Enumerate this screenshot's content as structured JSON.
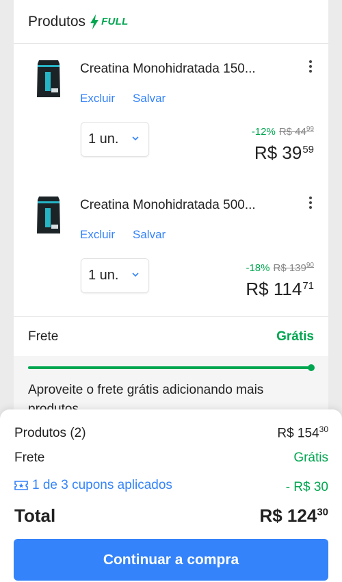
{
  "header": {
    "title": "Produtos",
    "badge": "FULL"
  },
  "items": [
    {
      "title": "Creatina Monohidratada 150...",
      "remove_label": "Excluir",
      "save_label": "Salvar",
      "quantity": "1 un.",
      "discount": "-12%",
      "old_price_int": "R$ 44",
      "old_price_cents": "99",
      "price_int": "R$ 39",
      "price_cents": "59"
    },
    {
      "title": "Creatina Monohidratada 500...",
      "remove_label": "Excluir",
      "save_label": "Salvar",
      "quantity": "1 un.",
      "discount": "-18%",
      "old_price_int": "R$ 139",
      "old_price_cents": "90",
      "price_int": "R$ 114",
      "price_cents": "71"
    }
  ],
  "shipping": {
    "label": "Frete",
    "value": "Grátis",
    "progress": 1.0,
    "message": "Aproveite o frete grátis adicionando mais produtos"
  },
  "summary": {
    "products_label": "Produtos (2)",
    "products_int": "R$ 154",
    "products_cents": "30",
    "shipping_label": "Frete",
    "shipping_value": "Grátis",
    "coupons_label": "1 de 3 cupons aplicados",
    "coupons_value": "- R$ 30",
    "total_label": "Total",
    "total_int": "R$ 124",
    "total_cents": "30",
    "cta_label": "Continuar a compra"
  },
  "colors": {
    "accent": "#3483fa",
    "success": "#00a650"
  }
}
